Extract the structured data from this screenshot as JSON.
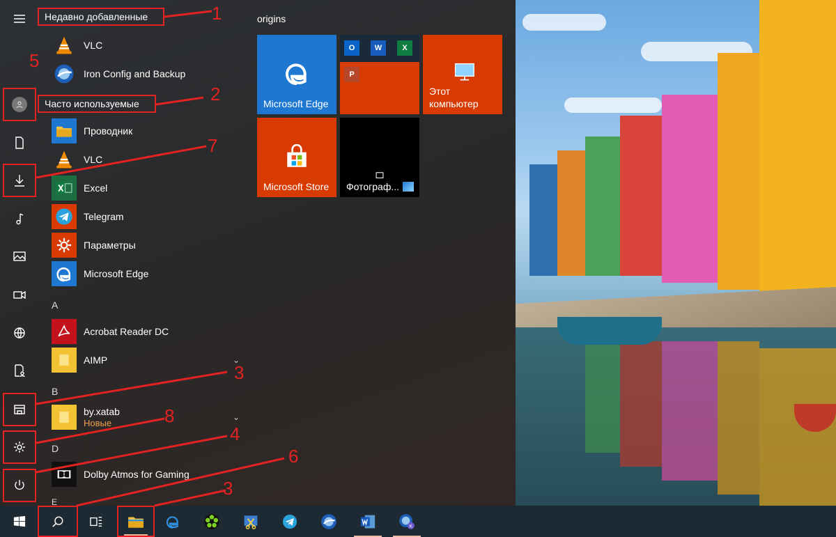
{
  "sections": {
    "recent": "Недавно добавленные",
    "frequent": "Часто используемые"
  },
  "recent_apps": [
    {
      "label": "VLC",
      "icon": "vlc-icon"
    },
    {
      "label": "Iron Config and Backup",
      "icon": "iron-config-icon"
    }
  ],
  "frequent_apps": [
    {
      "label": "Проводник",
      "icon": "folder-icon"
    },
    {
      "label": "VLC",
      "icon": "vlc-icon"
    },
    {
      "label": "Excel",
      "icon": "excel-icon"
    },
    {
      "label": "Telegram",
      "icon": "telegram-icon"
    },
    {
      "label": "Параметры",
      "icon": "gear-icon"
    },
    {
      "label": "Microsoft Edge",
      "icon": "edge-icon"
    }
  ],
  "letters": {
    "a": "A",
    "b": "B",
    "d": "D",
    "e": "E"
  },
  "alpha_apps": {
    "acrobat": "Acrobat Reader DC",
    "aimp": "AIMP",
    "xatab": "by.xatab",
    "xatab_sub": "Новые",
    "dolby": "Dolby Atmos for Gaming"
  },
  "tiles": {
    "group_title": "origins",
    "edge": "Microsoft Edge",
    "pc_line1": "Этот",
    "pc_line2": "компьютер",
    "store": "Microsoft Store",
    "photos": "Фотограф..."
  },
  "annotations": [
    "1",
    "2",
    "3",
    "4",
    "5",
    "6",
    "7",
    "8",
    "3"
  ],
  "colors": {
    "annotation": "#e32222",
    "tile_blue": "#1e78d2",
    "tile_orange": "#d83b01",
    "taskbar": "#1e2a33"
  }
}
